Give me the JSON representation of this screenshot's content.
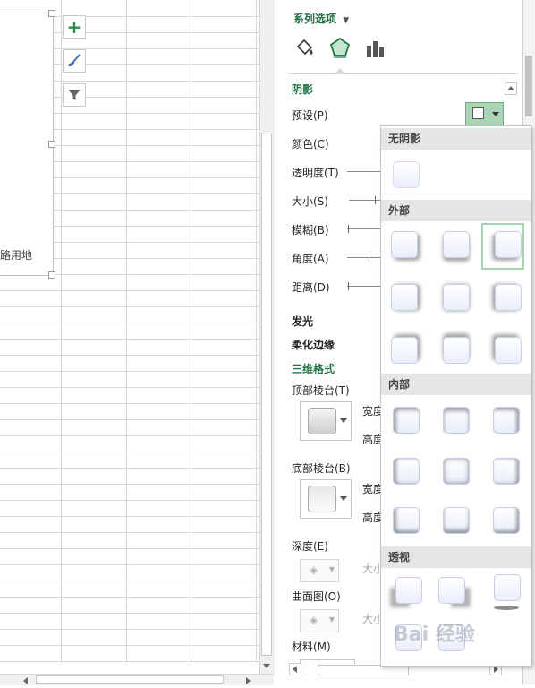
{
  "sheet": {
    "chart_label_partial": "路用地"
  },
  "panel": {
    "title": "系列选项",
    "tabs": [
      {
        "name": "fill-line",
        "icon": "paint-bucket-icon"
      },
      {
        "name": "effects",
        "icon": "pentagon-icon",
        "selected": true
      },
      {
        "name": "series-options",
        "icon": "bar-chart-icon"
      }
    ],
    "shadow": {
      "heading": "阴影",
      "preset": "预设(P)",
      "color": "颜色(C)",
      "transparency": "透明度(T)",
      "size": "大小(S)",
      "blur": "模糊(B)",
      "angle": "角度(A)",
      "distance": "距离(D)"
    },
    "glow": "发光",
    "soft_edges": "柔化边缘",
    "threed": {
      "heading": "三维格式",
      "top_bevel": "顶部棱台(T)",
      "bottom_bevel": "底部棱台(B)",
      "width": "宽度",
      "height": "高度",
      "depth": "深度(E)",
      "contour": "曲面图(O)",
      "size": "大小",
      "material": "材料(M)"
    }
  },
  "gallery": {
    "no_shadow": "无阴影",
    "outer": "外部",
    "inner": "内部",
    "perspective": "透视"
  },
  "watermark": "Bai 经验",
  "colors": {
    "accent": "#217346",
    "selected": "#a9d4b6"
  }
}
